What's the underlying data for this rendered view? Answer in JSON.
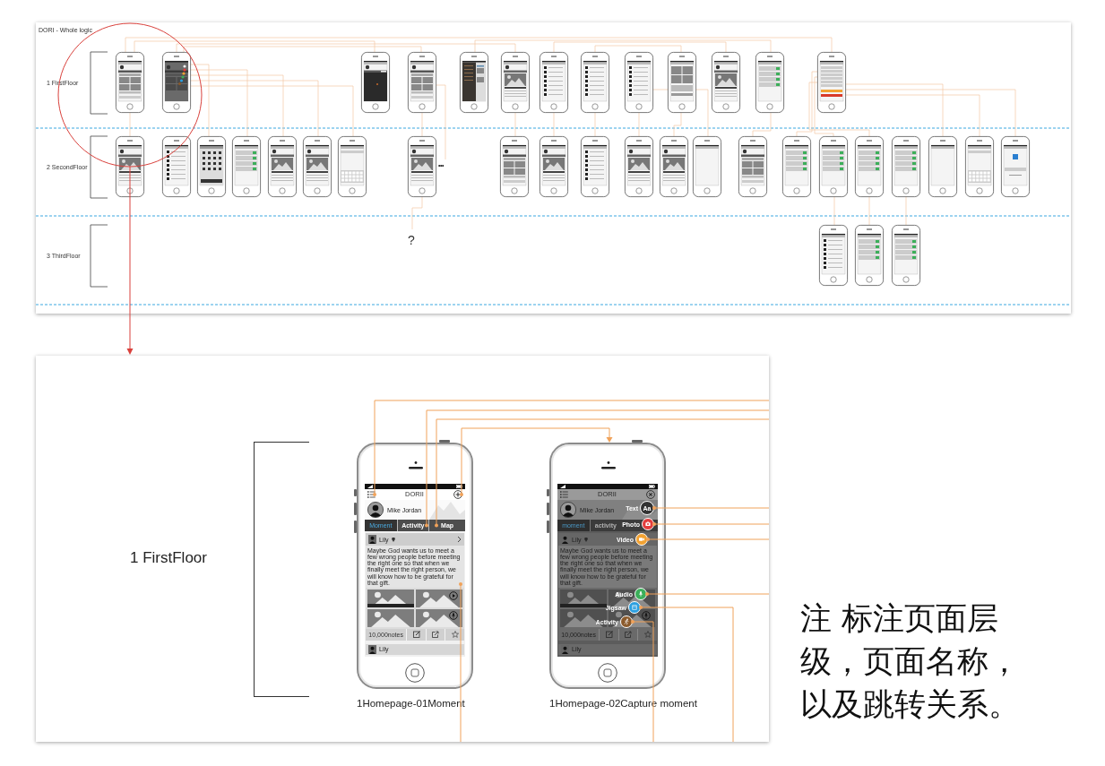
{
  "overview": {
    "title": "DORI - Whole logic",
    "floors": [
      {
        "label": "1 FirstFloor",
        "screens": [
          {
            "kind": "feed"
          },
          {
            "kind": "capture"
          },
          {
            "kind": "dark"
          },
          {
            "kind": "feed"
          },
          {
            "kind": "sidebar"
          },
          {
            "kind": "photo"
          },
          {
            "kind": "list"
          },
          {
            "kind": "list"
          },
          {
            "kind": "list"
          },
          {
            "kind": "gallery"
          },
          {
            "kind": "photo"
          },
          {
            "kind": "form"
          },
          {
            "kind": "settings"
          }
        ]
      },
      {
        "label": "2 SecondFloor",
        "screens": [
          {
            "kind": "photo"
          },
          {
            "kind": "list"
          },
          {
            "kind": "grid"
          },
          {
            "kind": "form"
          },
          {
            "kind": "photo"
          },
          {
            "kind": "photo"
          },
          {
            "kind": "keyboard"
          },
          {
            "kind": "photo"
          },
          {
            "kind": "feed"
          },
          {
            "kind": "photo"
          },
          {
            "kind": "list"
          },
          {
            "kind": "photo"
          },
          {
            "kind": "photo"
          },
          {
            "kind": "blank"
          },
          {
            "kind": "feed"
          },
          {
            "kind": "form"
          },
          {
            "kind": "form"
          },
          {
            "kind": "form"
          },
          {
            "kind": "form"
          },
          {
            "kind": "blank"
          },
          {
            "kind": "keyboard"
          },
          {
            "kind": "app"
          }
        ]
      },
      {
        "label": "3 ThirdFloor",
        "screens": [
          {
            "kind": "list"
          },
          {
            "kind": "form"
          },
          {
            "kind": "form"
          }
        ]
      }
    ],
    "question_mark": "?",
    "more": "•••"
  },
  "detail": {
    "floor_label": "1 FirstFloor",
    "phones": [
      {
        "kind": "moment",
        "caption": "1Homepage-01Moment",
        "dimmed": false,
        "header": {
          "title": "DORII"
        },
        "profile": {
          "name": "Mike Jordan"
        },
        "tabs": [
          {
            "label": "Moment",
            "selected": true
          },
          {
            "label": "Activity",
            "selected": false
          },
          {
            "label": "Map",
            "selected": false
          }
        ],
        "post": {
          "author": "Lily",
          "text": "Maybe God wants us to meet a few wrong people before meeting the right one so that when we finally meet the right person, we will know how to be grateful for that gift.",
          "tiles": [
            {
              "kind": "captioned"
            },
            {
              "kind": "video"
            },
            {
              "kind": "photo"
            },
            {
              "kind": "audio"
            }
          ],
          "count": "10,000notes"
        },
        "next_post": {
          "author": "Lily"
        }
      },
      {
        "kind": "capture",
        "caption": "1Homepage-02Capture moment",
        "dimmed": true,
        "header": {
          "title": "DORII"
        },
        "profile": {
          "name": "Mike Jordan"
        },
        "tabs": [
          {
            "label": "moment",
            "selected": true
          },
          {
            "label": "activity",
            "selected": false
          }
        ],
        "post": {
          "author": "Lily",
          "text": "Maybe God wants us to meet a few wrong people before meeting the right one so that when we finally meet the right person, we will know how to be grateful for that gift.",
          "tiles": [
            {
              "kind": "captioned"
            },
            {
              "kind": "photo"
            },
            {
              "kind": "photo"
            },
            {
              "kind": "audio"
            }
          ],
          "count": "10,000notes"
        },
        "next_post": {
          "author": "Lily"
        },
        "menu": [
          {
            "kind": "text",
            "label": "Text",
            "glyph": "Aa",
            "color": "#333333"
          },
          {
            "kind": "photo",
            "label": "Photo",
            "color": "#e23c3c"
          },
          {
            "kind": "video",
            "label": "Video",
            "color": "#f2a232"
          },
          {
            "kind": "audio",
            "label": "Audio",
            "color": "#3caf5a"
          },
          {
            "kind": "jigsaw",
            "label": "Jigsaw",
            "color": "#2b9fe0"
          },
          {
            "kind": "activity",
            "label": "Activity",
            "color": "#8b5a2b"
          }
        ]
      }
    ]
  },
  "note": "注 标注页面层级，页面名称，以及跳转关系。"
}
